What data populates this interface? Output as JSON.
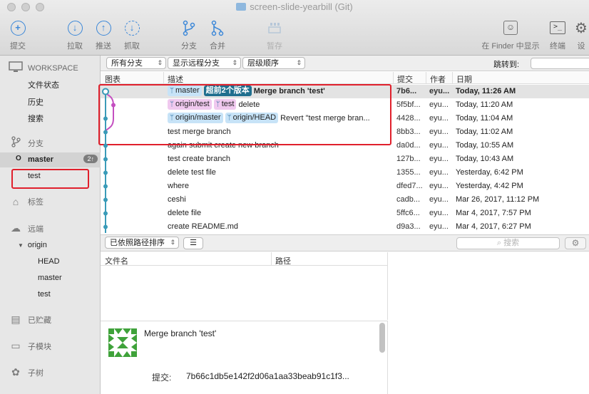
{
  "window": {
    "title": "screen-slide-yearbill (Git)"
  },
  "toolbar": {
    "commit": "提交",
    "pull": "拉取",
    "push": "推送",
    "fetch": "抓取",
    "branch": "分支",
    "merge": "合并",
    "stash": "暂存",
    "finder": "在 Finder 中显示",
    "terminal": "终端",
    "settings": "设"
  },
  "sidebar": {
    "workspace": "WORKSPACE",
    "ws_items": [
      "文件状态",
      "历史",
      "搜索"
    ],
    "branches": "分支",
    "branch_master": "master",
    "branch_badge": "2↑",
    "branch_test": "test",
    "tags": "标签",
    "remotes": "远端",
    "origin": "origin",
    "remote_items": [
      "HEAD",
      "master",
      "test"
    ],
    "stashes": "已贮藏",
    "submodules": "子模块",
    "subtrees": "子树"
  },
  "filters": {
    "branches": "所有分支",
    "remote": "显示远程分支",
    "order": "层级顺序",
    "jump_label": "跳转到:"
  },
  "columns": {
    "graph": "图表",
    "description": "描述",
    "commit": "提交",
    "author": "作者",
    "date": "日期"
  },
  "commits": [
    {
      "tags": [
        {
          "t": "master",
          "c": "blue",
          "icon": true
        },
        {
          "t": "超前2个版本",
          "c": "dark",
          "icon": false
        }
      ],
      "msg": "Merge branch 'test'",
      "hash": "7b6...",
      "author": "eyu...",
      "date": "Today, 11:26 AM"
    },
    {
      "tags": [
        {
          "t": "origin/test",
          "c": "pink",
          "icon": true
        },
        {
          "t": "test",
          "c": "pink",
          "icon": true
        }
      ],
      "msg": "delete",
      "hash": "5f5bf...",
      "author": "eyu...",
      "date": "Today, 11:20 AM"
    },
    {
      "tags": [
        {
          "t": "origin/master",
          "c": "blue",
          "icon": true
        },
        {
          "t": "origin/HEAD",
          "c": "blue",
          "icon": true
        }
      ],
      "msg": "Revert \"test merge bran...",
      "hash": "4428...",
      "author": "eyu...",
      "date": "Today, 11:04 AM"
    },
    {
      "tags": [],
      "msg": "test merge branch",
      "hash": "8bb3...",
      "author": "eyu...",
      "date": "Today, 11:02 AM"
    },
    {
      "tags": [],
      "msg": "again submit create new branch",
      "hash": "da0d...",
      "author": "eyu...",
      "date": "Today, 10:55 AM"
    },
    {
      "tags": [],
      "msg": "test create branch",
      "hash": "127b...",
      "author": "eyu...",
      "date": "Today, 10:43 AM"
    },
    {
      "tags": [],
      "msg": "delete test file",
      "hash": "1355...",
      "author": "eyu...",
      "date": "Yesterday, 6:42 PM"
    },
    {
      "tags": [],
      "msg": "where",
      "hash": "dfed7...",
      "author": "eyu...",
      "date": "Yesterday, 4:42 PM"
    },
    {
      "tags": [],
      "msg": "ceshi",
      "hash": "cadb...",
      "author": "eyu...",
      "date": "Mar 26, 2017, 11:12 PM"
    },
    {
      "tags": [],
      "msg": "delete file",
      "hash": "5ffc6...",
      "author": "eyu...",
      "date": "Mar 4, 2017, 7:57 PM"
    },
    {
      "tags": [],
      "msg": "create README.md",
      "hash": "d9a3...",
      "author": "eyu...",
      "date": "Mar 4, 2017, 6:27 PM"
    }
  ],
  "bottom": {
    "sort": "已依照路径排序",
    "search_placeholder": "搜索",
    "file_col": "文件名",
    "path_col": "路径"
  },
  "detail": {
    "subject": "Merge branch 'test'",
    "commit_label": "提交:",
    "commit_value": "7b66c1db5e142f2d06a1aa33beab91c1f3..."
  },
  "colors": {
    "accent": "#3b87d8",
    "graph_line": "#3a9bb8",
    "merge_line": "#c44fc0",
    "highlight": "#e0202c"
  }
}
